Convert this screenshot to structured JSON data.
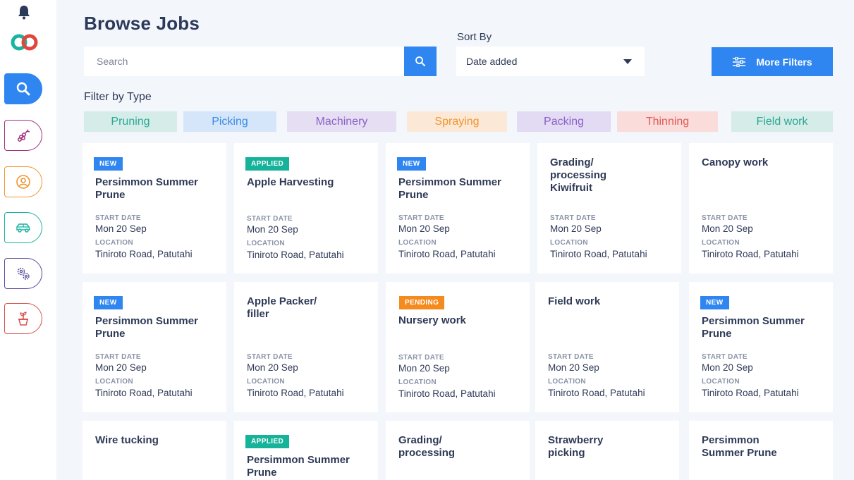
{
  "header": {
    "title": "Browse Jobs"
  },
  "search": {
    "placeholder": "Search"
  },
  "sort": {
    "label": "Sort By",
    "selected": "Date added"
  },
  "more_filters": {
    "label": "More Filters"
  },
  "filter_section": {
    "title": "Filter by Type"
  },
  "sidebar": {
    "items": [
      {
        "icon": "search-icon",
        "color": "#2f86f0",
        "active": true
      },
      {
        "icon": "grapes-icon",
        "color": "#a0307a",
        "active": false
      },
      {
        "icon": "person-icon",
        "color": "#f0952e",
        "active": false
      },
      {
        "icon": "car-icon",
        "color": "#18b4a0",
        "active": false
      },
      {
        "icon": "gears-icon",
        "color": "#5a4a9a",
        "active": false
      },
      {
        "icon": "plant-pot-icon",
        "color": "#d8504a",
        "active": false
      }
    ]
  },
  "filter_types": [
    {
      "label": "Pruning",
      "bg": "#d6ece9",
      "fg": "#29a894"
    },
    {
      "label": "Picking",
      "bg": "#d5e6fa",
      "fg": "#3b8ae6"
    },
    {
      "label": "Machinery",
      "bg": "#e6def3",
      "fg": "#8a62c9"
    },
    {
      "label": "Spraying",
      "bg": "#fce8d6",
      "fg": "#f0952e"
    },
    {
      "label": "Packing",
      "bg": "#e3daf3",
      "fg": "#8a62c9"
    },
    {
      "label": "Thinning",
      "bg": "#fadcdb",
      "fg": "#df5a56"
    },
    {
      "label": "Field work",
      "bg": "#d6ece9",
      "fg": "#29a894"
    }
  ],
  "jobs": [
    {
      "badge": "NEW",
      "title": "Persimmon Summer Prune",
      "start_label": "START DATE",
      "start": "Mon 20 Sep",
      "location_label": "LOCATION",
      "location": "Tiniroto Road, Patutahi"
    },
    {
      "badge": "APPLIED",
      "title": "Apple Harvesting",
      "start_label": "START DATE",
      "start": "Mon 20 Sep",
      "location_label": "LOCATION",
      "location": "Tiniroto Road, Patutahi"
    },
    {
      "badge": "NEW",
      "title": "Persimmon Summer Prune",
      "start_label": "START DATE",
      "start": "Mon 20 Sep",
      "location_label": "LOCATION",
      "location": "Tiniroto Road, Patutahi"
    },
    {
      "badge": "",
      "title": "Grading/ processing Kiwifruit",
      "start_label": "START DATE",
      "start": "Mon 20 Sep",
      "location_label": "LOCATION",
      "location": "Tiniroto Road, Patutahi"
    },
    {
      "badge": "",
      "title": "Canopy work",
      "start_label": "START DATE",
      "start": "Mon 20 Sep",
      "location_label": "LOCATION",
      "location": "Tiniroto Road, Patutahi"
    },
    {
      "badge": "NEW",
      "title": "Persimmon Summer Prune",
      "start_label": "START DATE",
      "start": "Mon 20 Sep",
      "location_label": "LOCATION",
      "location": "Tiniroto Road, Patutahi"
    },
    {
      "badge": "",
      "title": "Apple Packer/ filler",
      "start_label": "START DATE",
      "start": "Mon 20 Sep",
      "location_label": "LOCATION",
      "location": "Tiniroto Road, Patutahi"
    },
    {
      "badge": "PENDING",
      "title": "Nursery work",
      "start_label": "START DATE",
      "start": "Mon 20 Sep",
      "location_label": "LOCATION",
      "location": "Tiniroto Road, Patutahi"
    },
    {
      "badge": "",
      "title": "Field work",
      "start_label": "START DATE",
      "start": "Mon 20 Sep",
      "location_label": "LOCATION",
      "location": "Tiniroto Road, Patutahi"
    },
    {
      "badge": "NEW",
      "title": "Persimmon Summer Prune",
      "start_label": "START DATE",
      "start": "Mon 20 Sep",
      "location_label": "LOCATION",
      "location": "Tiniroto Road, Patutahi"
    },
    {
      "badge": "",
      "title": "Wire tucking"
    },
    {
      "badge": "APPLIED",
      "title": "Persimmon Summer Prune"
    },
    {
      "badge": "",
      "title": "Grading/ processing"
    },
    {
      "badge": "",
      "title": "Strawberry picking"
    },
    {
      "badge": "",
      "title": "Persimmon Summer Prune"
    }
  ]
}
